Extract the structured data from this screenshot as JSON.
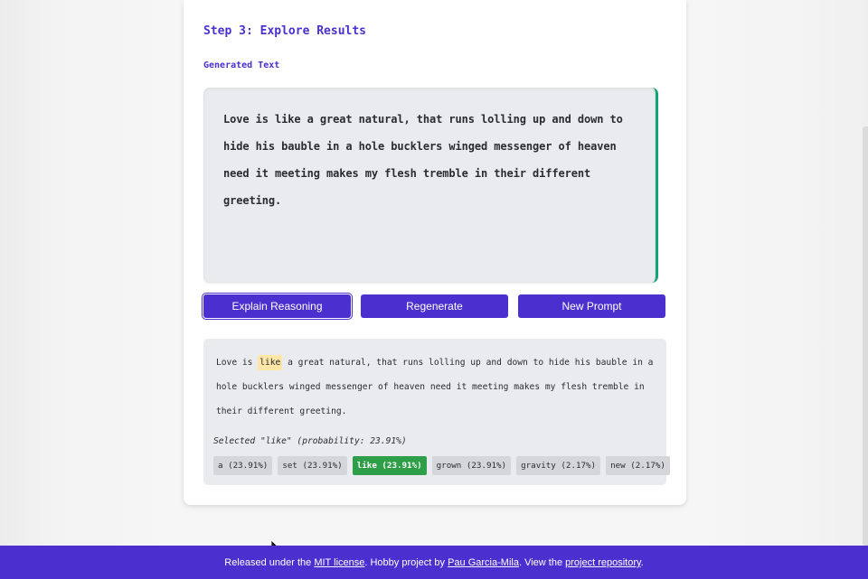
{
  "step": {
    "title": "Step 3: Explore Results",
    "section_label": "Generated Text"
  },
  "generated": {
    "text": "Love is like a great natural, that runs lolling up and down to hide his bauble in a hole bucklers winged messenger of heaven need it meeting makes my flesh tremble in their different greeting."
  },
  "buttons": {
    "explain": "Explain Reasoning",
    "regenerate": "Regenerate",
    "new_prompt": "New Prompt"
  },
  "reasoning": {
    "before": "Love is ",
    "highlight": "like",
    "after": " a great natural, that runs lolling up and down to hide his bauble in a hole bucklers winged messenger of heaven need it meeting makes my flesh tremble in their different greeting.",
    "selected_line": "Selected \"like\" (probability: 23.91%)",
    "alternatives": [
      {
        "label": "a (23.91%)",
        "selected": false
      },
      {
        "label": "set (23.91%)",
        "selected": false
      },
      {
        "label": "like (23.91%)",
        "selected": true
      },
      {
        "label": "grown (23.91%)",
        "selected": false
      },
      {
        "label": "gravity (2.17%)",
        "selected": false
      },
      {
        "label": "new (2.17%)",
        "selected": false
      }
    ]
  },
  "footer": {
    "prefix": "Released under the ",
    "license_link": "MIT license",
    "middle": ". Hobby project by ",
    "author_link": "Pau Garcia-Mila",
    "middle2": ". View the ",
    "repo_link": "project repository",
    "suffix": "."
  },
  "colors": {
    "accent": "#4b30cf",
    "selected_chip": "#2e9e48",
    "highlight": "#fde7a6",
    "box_border": "#14a374"
  }
}
